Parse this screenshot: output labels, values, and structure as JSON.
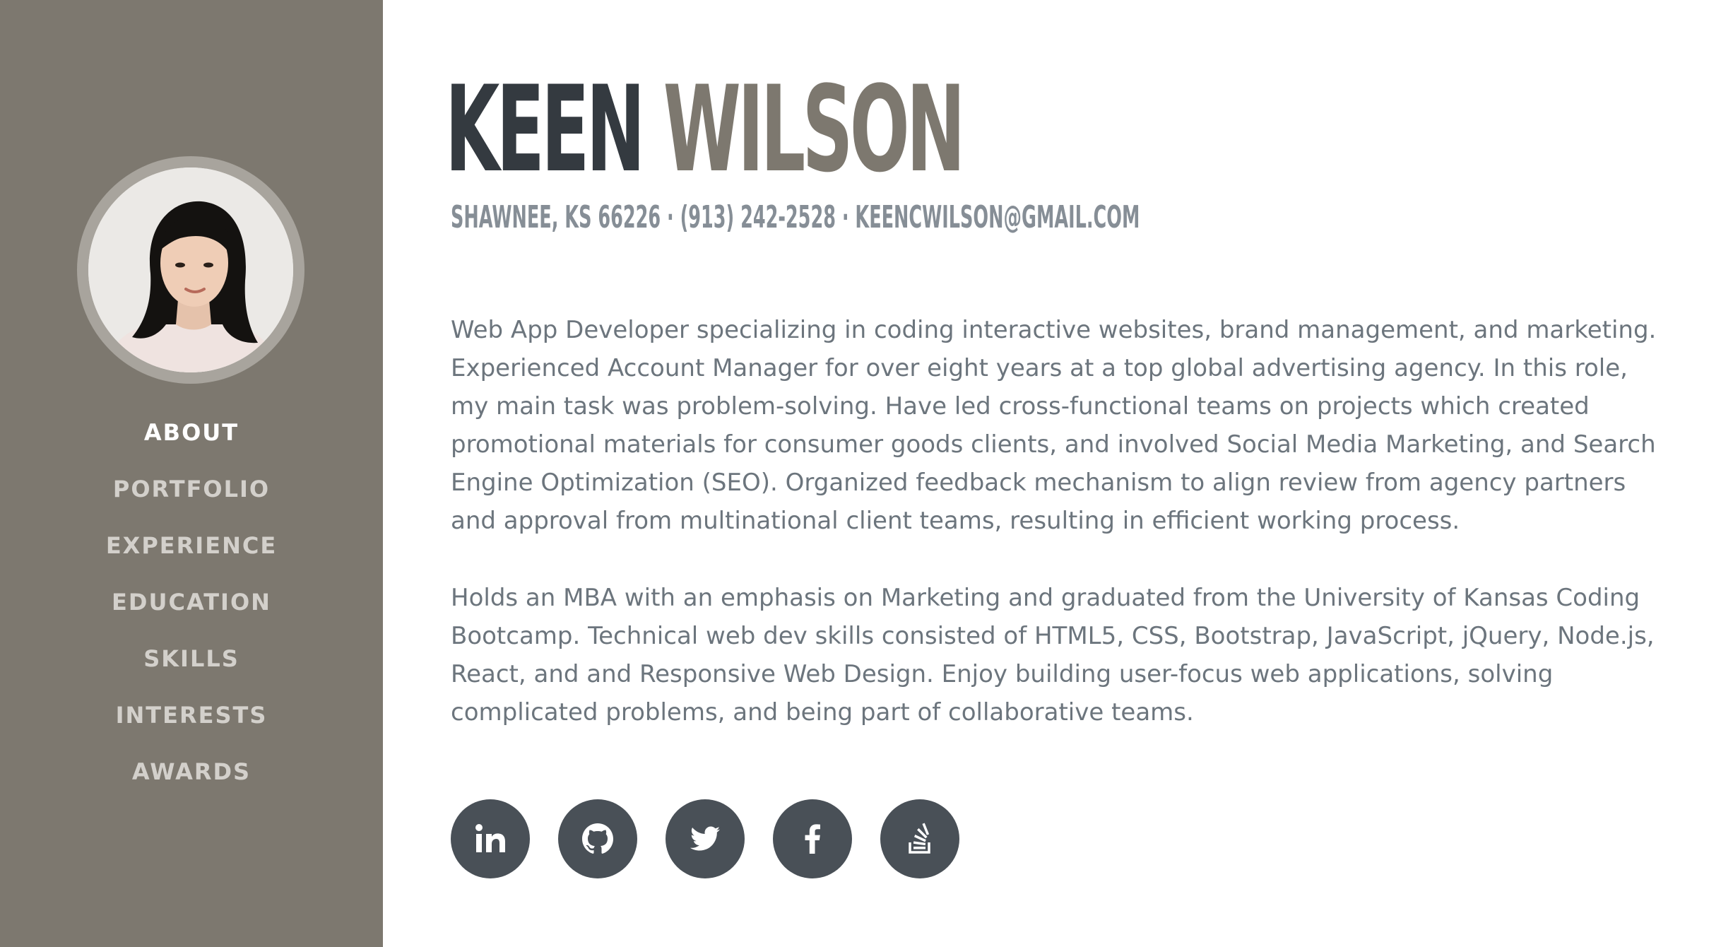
{
  "profile": {
    "first_name": "KEEN",
    "last_name": "WILSON",
    "contact_line": "SHAWNEE, KS 66226 · (913) 242-2528 · KEENCWILSON@GMAIL.COM"
  },
  "nav": {
    "items": [
      {
        "label": "ABOUT",
        "active": true
      },
      {
        "label": "PORTFOLIO"
      },
      {
        "label": "EXPERIENCE"
      },
      {
        "label": "EDUCATION"
      },
      {
        "label": "SKILLS"
      },
      {
        "label": "INTERESTS"
      },
      {
        "label": "AWARDS"
      }
    ]
  },
  "about": {
    "paragraph1": [
      "Web App Developer specializing in coding interactive websites, brand management, and marketing.",
      "Experienced Account Manager for over eight years at a top global advertising agency. In this role,",
      "my main task was problem-solving. Have led cross-functional teams on projects which created",
      "promotional materials for consumer goods clients, and involved Social Media Marketing, and Search",
      "Engine Optimization (SEO). Organized feedback mechanism to align review from agency partners",
      "and approval from multinational client teams, resulting in efficient working process."
    ],
    "paragraph2": [
      "Holds an MBA with an emphasis on Marketing and graduated from the University of Kansas Coding",
      "Bootcamp. Technical web dev skills consisted of HTML5, CSS, Bootstrap, JavaScript, jQuery, Node.js,",
      "React, and and Responsive Web Design. Enjoy building user-focus web applications, solving",
      "complicated problems, and being part of collaborative teams."
    ]
  },
  "social": [
    {
      "icon": "linkedin-icon"
    },
    {
      "icon": "github-icon"
    },
    {
      "icon": "twitter-icon"
    },
    {
      "icon": "facebook-icon"
    },
    {
      "icon": "stack-overflow-icon"
    }
  ],
  "colors": {
    "sidebar": "#7d786f",
    "name_first": "#343a40",
    "name_last": "#7d786f",
    "body_text": "#6c757d",
    "social_button": "#495057"
  }
}
